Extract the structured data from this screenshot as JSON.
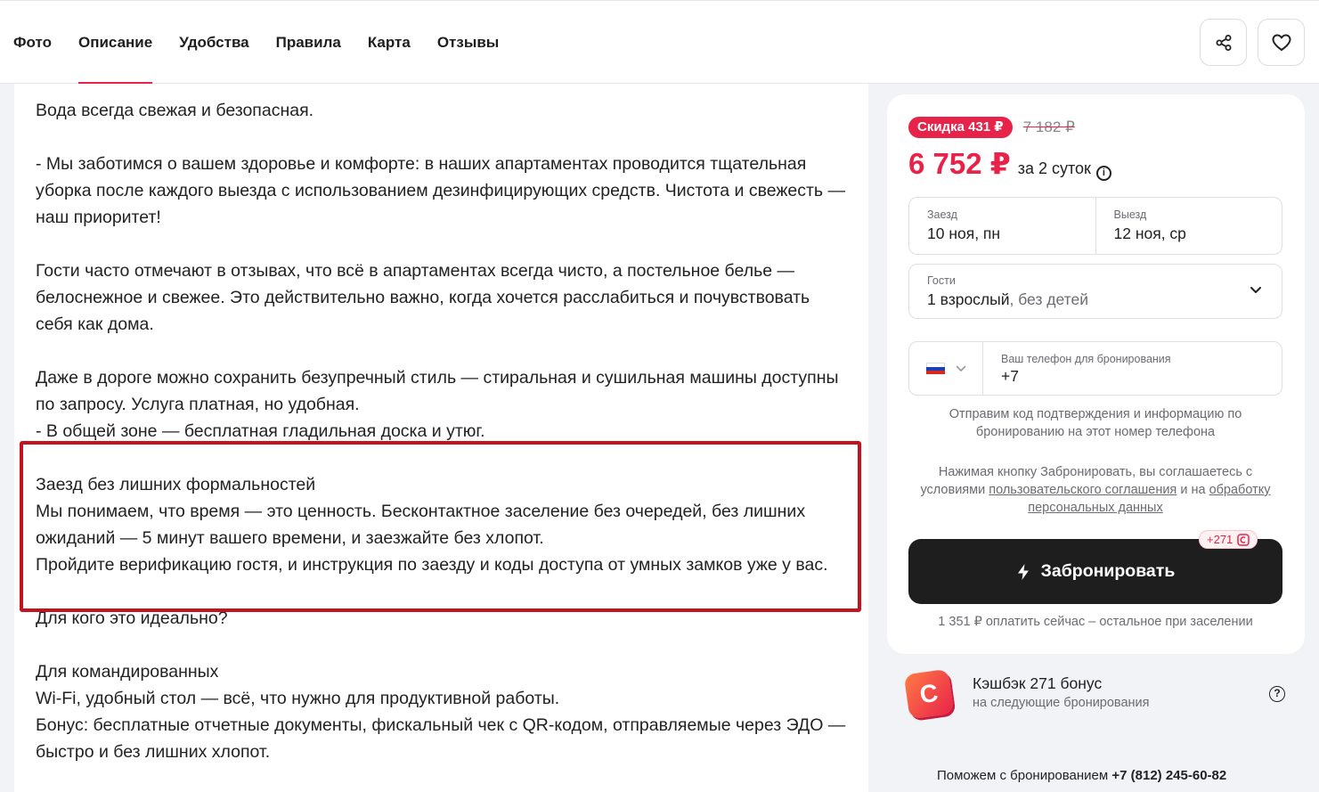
{
  "nav": {
    "tabs": [
      {
        "label": "Фото",
        "active": false
      },
      {
        "label": "Описание",
        "active": true
      },
      {
        "label": "Удобства",
        "active": false
      },
      {
        "label": "Правила",
        "active": false
      },
      {
        "label": "Карта",
        "active": false
      },
      {
        "label": "Отзывы",
        "active": false
      }
    ],
    "share_icon": "share-icon",
    "favorite_icon": "heart-icon"
  },
  "description": {
    "paragraphs": [
      "Вода всегда свежая и безопасная.",
      "",
      "- Мы заботимся о вашем здоровье и комфорте: в наших апартаментах проводится тщательная уборка после каждого выезда с использованием дезинфицирующих средств. Чистота и свежесть — наш приоритет!",
      "",
      "Гости часто отмечают в отзывах, что всё в апартаментах всегда чисто, а постельное белье — белоснежное и свежее. Это действительно важно, когда хочется расслабиться и почувствовать себя как дома.",
      "",
      "Даже в дороге можно сохранить безупречный стиль — стиральная и сушильная машины доступны по запросу. Услуга платная, но удобная.",
      "- В общей зоне — бесплатная гладильная доска и утюг.",
      "",
      "Заезд без лишних формальностей",
      "Мы понимаем, что время — это ценность. Бесконтактное заселение без очередей, без лишних ожиданий — 5 минут вашего времени, и заезжайте без хлопот.",
      "Пройдите верификацию гостя, и инструкция по заезду и коды доступа от умных замков уже у вас.",
      "",
      "Для кого это идеально?",
      "",
      "Для командированных",
      "Wi-Fi, удобный стол — всё, что нужно для продуктивной работы.",
      "Бонус: бесплатные отчетные документы, фискальный чек с QR-кодом, отправляемые через ЭДО — быстро и без лишних хлопот."
    ]
  },
  "booking": {
    "discount_label": "Скидка 431 ₽",
    "old_price": "7 182 ₽",
    "price": "6 752 ₽",
    "per_label": "за 2 суток",
    "info_glyph": "i",
    "checkin_label": "Заезд",
    "checkin_value": "10 ноя, пн",
    "checkout_label": "Выезд",
    "checkout_value": "12 ноя, ср",
    "guests_label": "Гости",
    "guests_main": "1 взрослый",
    "guests_sub": ", без детей",
    "phone_label": "Ваш телефон для бронирования",
    "phone_value": "+7",
    "sms_note": "Отправим код подтверждения и информацию по бронированию на этот номер телефона",
    "terms_prefix": "Нажимая кнопку Забронировать, вы соглашаетесь с условиями ",
    "terms_link1": "пользовательского соглашения",
    "terms_mid": " и на ",
    "terms_link2": "обработку персональных данных",
    "bonus_tag": "+271",
    "book_label": "Забронировать",
    "pay_note": "1 351 ₽ оплатить сейчас – остальное при заселении"
  },
  "cashback": {
    "logo_letter": "C",
    "title": "Кэшбэк 271 бонус",
    "subtitle": "на следующие бронирования",
    "help_glyph": "?"
  },
  "help": {
    "prefix": "Поможем с бронированием ",
    "phone": "+7 (812) 245-60-82"
  },
  "colors": {
    "accent": "#e8234a",
    "dark_button": "#1e1e1e",
    "highlight_border": "#c4121e"
  }
}
